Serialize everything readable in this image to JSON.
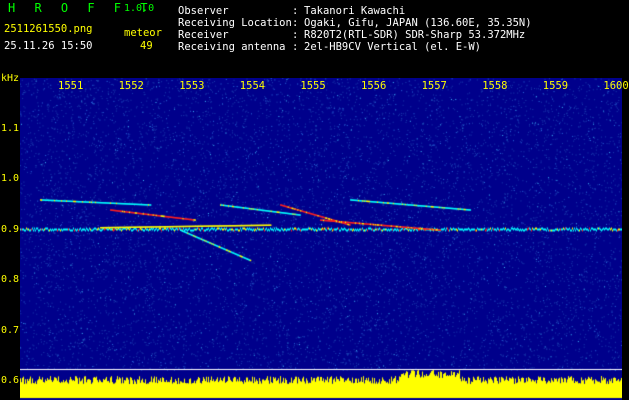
{
  "header": {
    "app_title": "H R O F F T",
    "version": "1.0.0",
    "file_name": "2511261550.png",
    "meteor_label": "meteor",
    "timestamp": "25.11.26 15:50",
    "meteor_count": "49"
  },
  "station": {
    "rows": [
      {
        "key": "Observer",
        "value": "Takanori Kawachi"
      },
      {
        "key": "Receiving Location",
        "value": "Ogaki, Gifu, JAPAN (136.60E, 35.35N)"
      },
      {
        "key": "Receiver",
        "value": "R820T2(RTL-SDR) SDR-Sharp 53.372MHz"
      },
      {
        "key": "Receiving antenna",
        "value": "2el-HB9CV Vertical (el. E-W)"
      }
    ],
    "separator": ":"
  },
  "chart_data": {
    "type": "heatmap",
    "x_ticks": [
      "1551",
      "1552",
      "1553",
      "1554",
      "1555",
      "1556",
      "1557",
      "1558",
      "1559",
      "1600"
    ],
    "y_unit": "kHz",
    "y_ticks": [
      "1.1",
      "1.0",
      "0.9",
      "0.8",
      "0.7",
      "0.6"
    ],
    "ylim": [
      0.6,
      1.12
    ],
    "carrier_khz": 0.9,
    "colors": {
      "background": "#00008b",
      "noise": "#1040c0",
      "text": "#ffff00",
      "meta": "#ffffff",
      "title": "#00ff00",
      "signal_hot": "#ff2020",
      "signal_warm": "#ffff00",
      "signal": "#00ffff",
      "level_bar": "#ffff00"
    }
  }
}
